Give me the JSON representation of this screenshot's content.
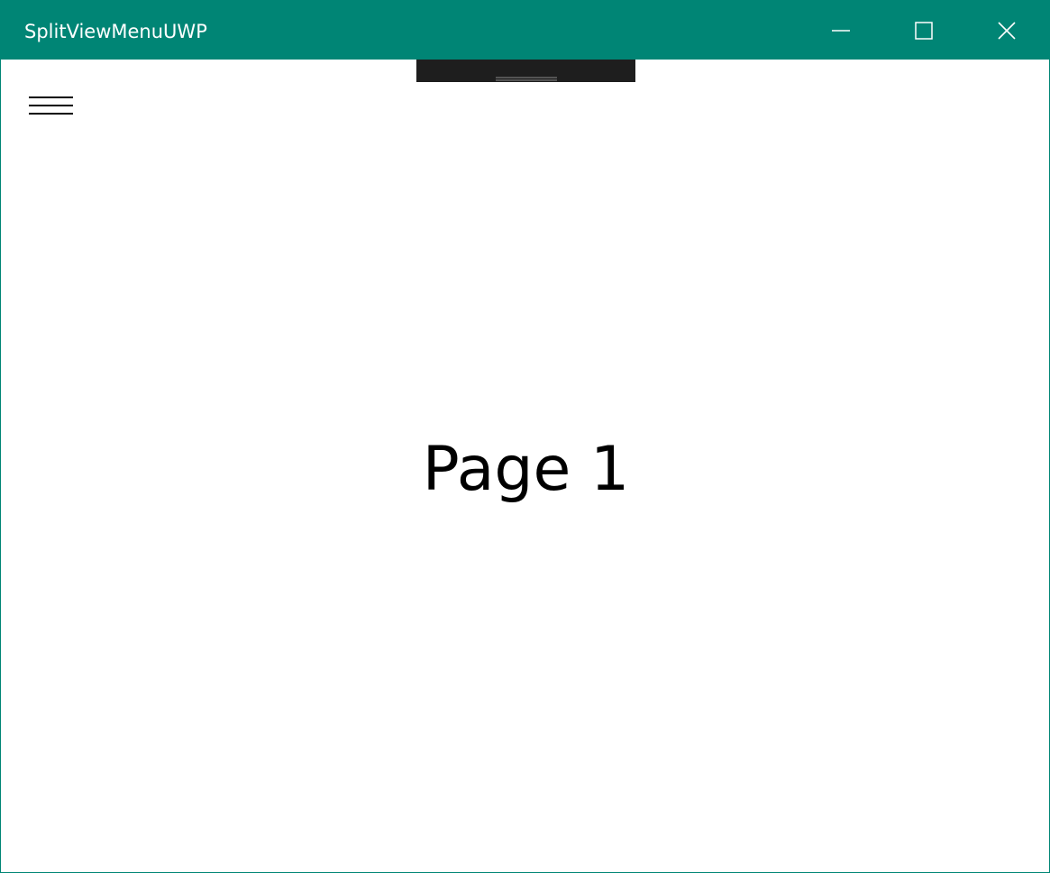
{
  "window": {
    "title": "SplitViewMenuUWP",
    "accent_color": "#008575",
    "caption_buttons": [
      {
        "name": "minimize",
        "icon": "minimize-icon"
      },
      {
        "name": "maximize",
        "icon": "maximize-icon"
      },
      {
        "name": "close",
        "icon": "close-icon"
      }
    ]
  },
  "toolbar": {
    "icon": "drag-handle-icon",
    "color": "#1e1e1e"
  },
  "nav": {
    "menu_icon": "hamburger-menu-icon"
  },
  "content": {
    "page_title": "Page 1"
  }
}
